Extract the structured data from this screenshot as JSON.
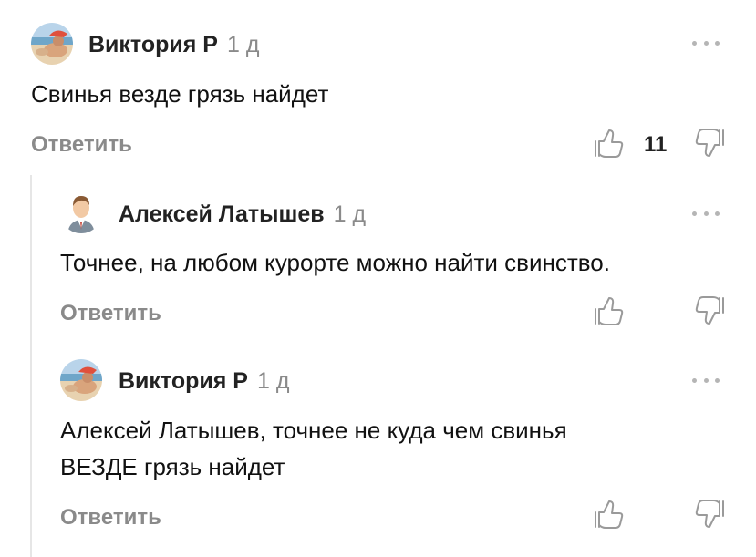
{
  "colors": {
    "text": "#111111",
    "muted": "#8a8a8a",
    "thread_line": "#e6e6e6"
  },
  "comments": [
    {
      "author": "Виктория Р",
      "time": "1 д",
      "text": "Свинья везде грязь найдет",
      "reply_label": "Ответить",
      "likes": "11",
      "avatar_icon": "beach-photo-avatar",
      "more_icon": "more-dots-icon"
    },
    {
      "author": "Алексей Латышев",
      "time": "1 д",
      "text": "Точнее, на любом курорте можно найти свинство.",
      "reply_label": "Ответить",
      "avatar_icon": "businessman-avatar",
      "more_icon": "more-dots-icon"
    },
    {
      "author": "Виктория Р",
      "time": "1 д",
      "text_line1": "Алексей Латышев, точнее не куда чем свинья",
      "text_line2": "ВЕЗДЕ грязь найдет",
      "reply_label": "Ответить",
      "avatar_icon": "beach-photo-avatar",
      "more_icon": "more-dots-icon"
    }
  ]
}
